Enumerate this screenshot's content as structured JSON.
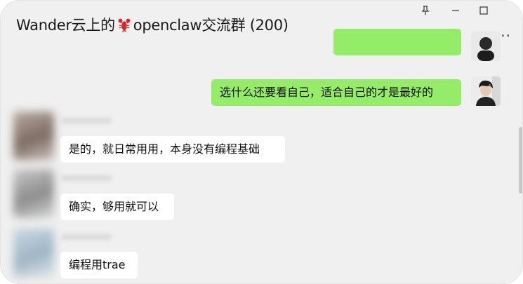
{
  "window": {
    "title": "Wander云上的",
    "title_suffix": "openclaw交流群 (200)",
    "more_label": "...",
    "pin_icon": "pin-icon",
    "min_icon": "minimize-icon",
    "max_icon": "maximize-icon"
  },
  "messages": [
    {
      "sender": "me",
      "text": "选什么还要看自己，适合自己的才是最好的"
    },
    {
      "sender": "other",
      "text": "是的，就日常用用，本身没有编程基础"
    },
    {
      "sender": "other",
      "text": "确实，够用就可以"
    },
    {
      "sender": "other",
      "text": "编程用trae"
    }
  ],
  "colors": {
    "self_bubble": "#95ec69",
    "other_bubble": "#ffffff",
    "chat_background": "#f0f0f0"
  }
}
